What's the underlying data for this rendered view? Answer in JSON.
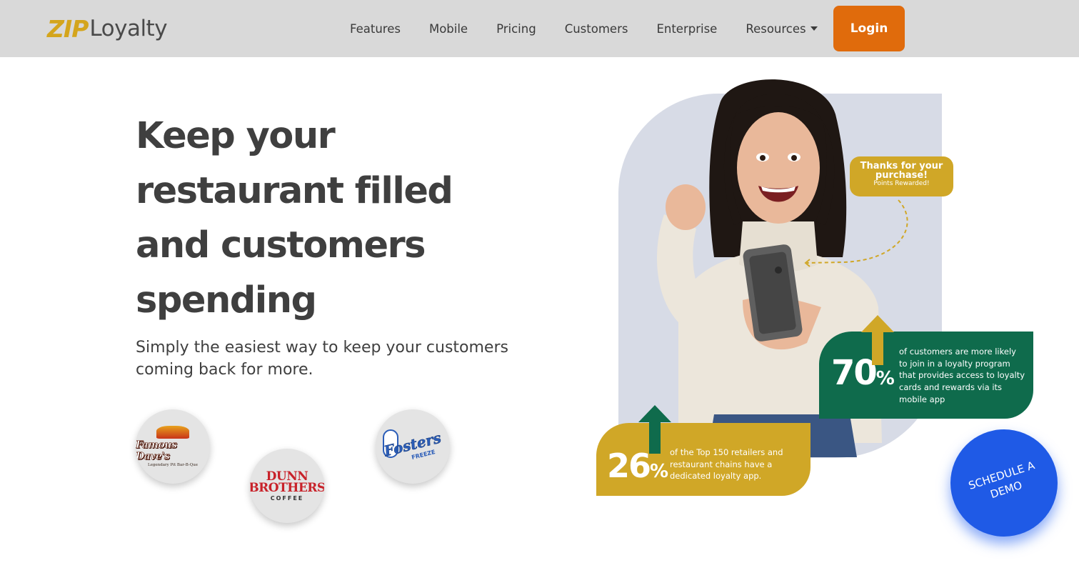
{
  "nav": {
    "logo_zip": "ZIP",
    "logo_loyalty": "Loyalty",
    "links": [
      "Features",
      "Mobile",
      "Pricing",
      "Customers",
      "Enterprise",
      "Resources"
    ],
    "login_label": "Login"
  },
  "hero": {
    "headline_lines": [
      "Keep your",
      "restaurant filled",
      "and customers",
      "spending"
    ],
    "subline": "Simply the easiest way to keep your customers coming back for more."
  },
  "customers": [
    {
      "name": "Famous Dave's",
      "tagline": "Legendary Pit Bar-B-Que"
    },
    {
      "line1": "DUNN",
      "line2": "BROTHERS",
      "line3": "COFFEE"
    },
    {
      "name": "Fosters",
      "sub": "FREEZE"
    }
  ],
  "bubble": {
    "title": "Thanks for your purchase!",
    "subtitle": "Points Rewarded!"
  },
  "stats": {
    "s70": {
      "number": "70",
      "unit": "%",
      "text": "of customers are more likely to join in a loyalty program that provides access to loyalty cards and rewards via its mobile app"
    },
    "s26": {
      "number": "26",
      "unit": "%",
      "text": "of the Top 150 retailers and restaurant chains have a dedicated loyalty app."
    }
  },
  "demo_label": "SCHEDULE A DEMO",
  "colors": {
    "nav_bg": "#d9d9d9",
    "brand_gold": "#d4a51c",
    "login_orange": "#e06b0c",
    "stat_green": "#0f6b4c",
    "stat_gold": "#d0a727",
    "demo_blue": "#1f5ae6",
    "text_dark": "#3f3f3f"
  },
  "icons": {
    "resources_caret": "chevron-down-icon",
    "stat_arrow": "arrow-up-icon",
    "logo_badge": "ribbon-badge-icon"
  }
}
